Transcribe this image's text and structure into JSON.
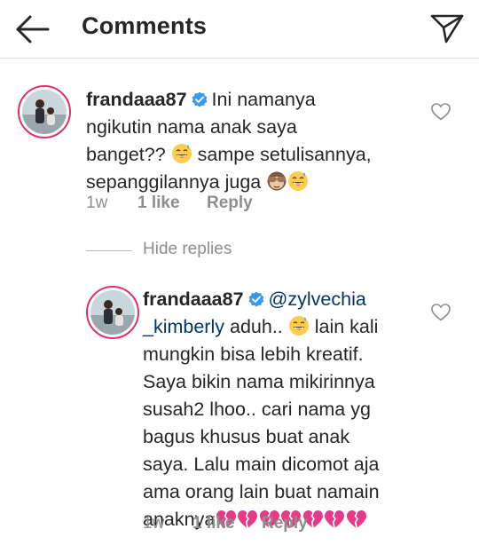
{
  "header": {
    "title": "Comments",
    "back_icon": "arrow-left-icon",
    "share_icon": "paper-plane-icon"
  },
  "comments": [
    {
      "username": "frandaaa87",
      "verified": true,
      "lines": [
        "Ini namanya",
        "ngikutin nama anak saya",
        "banget??",
        "sampe setulisannya,",
        "sepanggilannya juga"
      ],
      "emojis": [
        "grinning-sweat-emoji",
        "see-no-evil-monkey-emoji",
        "grinning-sweat-emoji"
      ],
      "time": "1w",
      "likes": "1 like",
      "reply_label": "Reply"
    }
  ],
  "replies_toggle": "Hide replies",
  "replies": [
    {
      "username": "frandaaa87",
      "verified": true,
      "mention_part1": "@zylvechia",
      "mention_part2": "_kimberly",
      "lines": [
        "aduh..",
        "lain kali",
        "mungkin bisa lebih kreatif.",
        "Saya bikin nama mikirinnya",
        "susah2 lhoo.. cari nama yg",
        "bagus khusus buat anak",
        "saya. Lalu main dicomot aja",
        "ama orang lain buat namain",
        "anaknya"
      ],
      "broken_heart_count": 7,
      "time": "1w",
      "likes": "1 like",
      "reply_label": "Reply"
    }
  ],
  "colors": {
    "text": "#262626",
    "secondary": "#8e8e8e",
    "verified_blue": "#3897f0",
    "mention": "#003569",
    "story_ring": "#e1306c",
    "broken_heart": "#e8388a"
  }
}
